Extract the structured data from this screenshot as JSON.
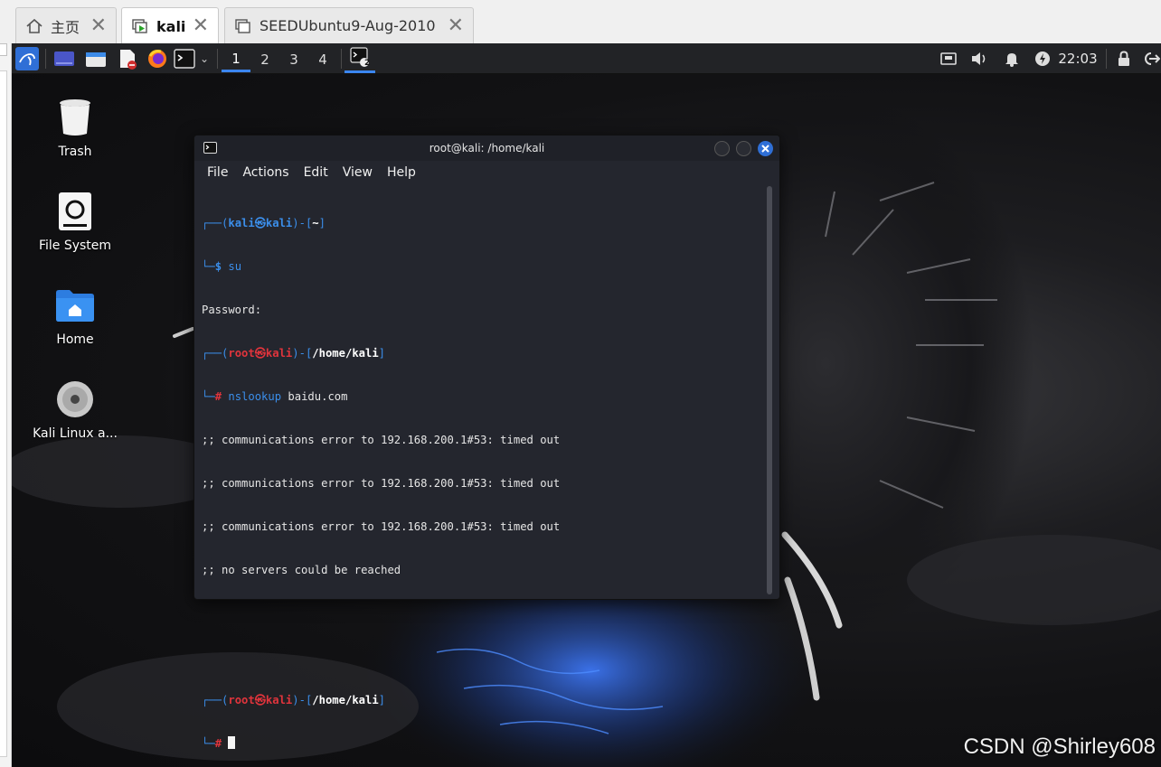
{
  "vm_tabs": [
    {
      "label": "主页",
      "icon": "home-icon",
      "active": false
    },
    {
      "label": "kali",
      "icon": "vm-running-icon",
      "active": true
    },
    {
      "label": "SEEDUbuntu9-Aug-2010",
      "icon": "vm-icon",
      "active": false
    }
  ],
  "panel": {
    "workspaces": [
      "1",
      "2",
      "3",
      "4"
    ],
    "active_workspace": "1",
    "taskbar_badge": "2",
    "clock": "22:03",
    "icons": [
      "kali-menu-icon",
      "desktop-icon",
      "file-manager-icon",
      "text-editor-icon",
      "firefox-icon",
      "terminal-icon",
      "network-icon",
      "volume-icon",
      "notifications-icon",
      "power-icon",
      "lock-icon",
      "logout-icon"
    ]
  },
  "desktop_icons": [
    {
      "label": "Trash",
      "icon": "trash-icon"
    },
    {
      "label": "File System",
      "icon": "drive-icon"
    },
    {
      "label": "Home",
      "icon": "home-folder-icon"
    },
    {
      "label": "Kali Linux a...",
      "icon": "disc-icon"
    }
  ],
  "terminal": {
    "title": "root@kali: /home/kali",
    "menu": [
      "File",
      "Actions",
      "Edit",
      "View",
      "Help"
    ],
    "prompt1": {
      "user": "kali",
      "host": "kali",
      "dir": "~",
      "symbol": "$",
      "command": "su"
    },
    "password_line": "Password:",
    "prompt2": {
      "user": "root",
      "host": "kali",
      "dir": "/home/kali",
      "symbol": "#",
      "command": "nslookup",
      "arg": "baidu.com"
    },
    "output": [
      ";; communications error to 192.168.200.1#53: timed out",
      ";; communications error to 192.168.200.1#53: timed out",
      ";; communications error to 192.168.200.1#53: timed out",
      ";; no servers could be reached"
    ],
    "prompt3": {
      "user": "root",
      "host": "kali",
      "dir": "/home/kali",
      "symbol": "#"
    },
    "at_symbol": "㉿",
    "bracket_open": "(",
    "bracket_close": ")",
    "dash_bracket": "-[",
    "close_bracket": "]",
    "corner_top": "┌──",
    "corner_bottom": "└─"
  },
  "watermark": "CSDN @Shirley608",
  "colors": {
    "accent": "#3b86f0",
    "root_red": "#e0343c",
    "prompt_blue": "#3b8eea"
  }
}
